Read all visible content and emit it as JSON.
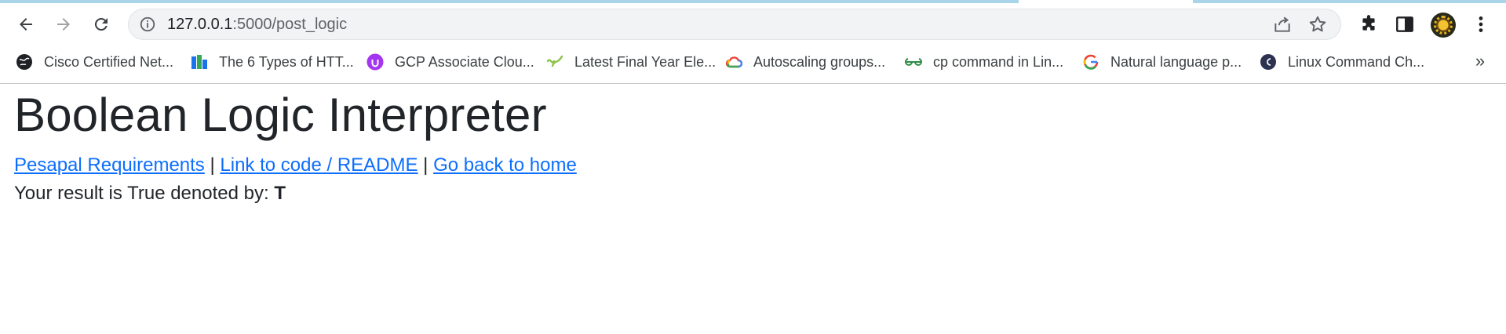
{
  "browser": {
    "url_host": "127.0.0.1",
    "url_rest": ":5000/post_logic",
    "bookmarks": [
      {
        "label": "Cisco Certified Net...",
        "icon": "cisco-globe-icon"
      },
      {
        "label": "The 6 Types of HTT...",
        "icon": "hashnode-icon"
      },
      {
        "label": "GCP Associate Clou...",
        "icon": "udemy-icon"
      },
      {
        "label": "Latest Final Year Ele...",
        "icon": "green-squiggle-icon"
      },
      {
        "label": "Autoscaling groups...",
        "icon": "google-cloud-icon"
      },
      {
        "label": "cp command in Lin...",
        "icon": "geeksforgeeks-icon"
      },
      {
        "label": "Natural language p...",
        "icon": "google-g-icon"
      },
      {
        "label": "Linux Command Ch...",
        "icon": "circle-letter-icon"
      }
    ],
    "more_label": "»"
  },
  "page": {
    "title": "Boolean Logic Interpreter",
    "links": {
      "requirements": "Pesapal Requirements",
      "sep1": "|",
      "code": "Link to code / README",
      "sep2": "|",
      "home": "Go back to home"
    },
    "result_prefix": "Your result is True denoted by:",
    "result_value": "T"
  }
}
